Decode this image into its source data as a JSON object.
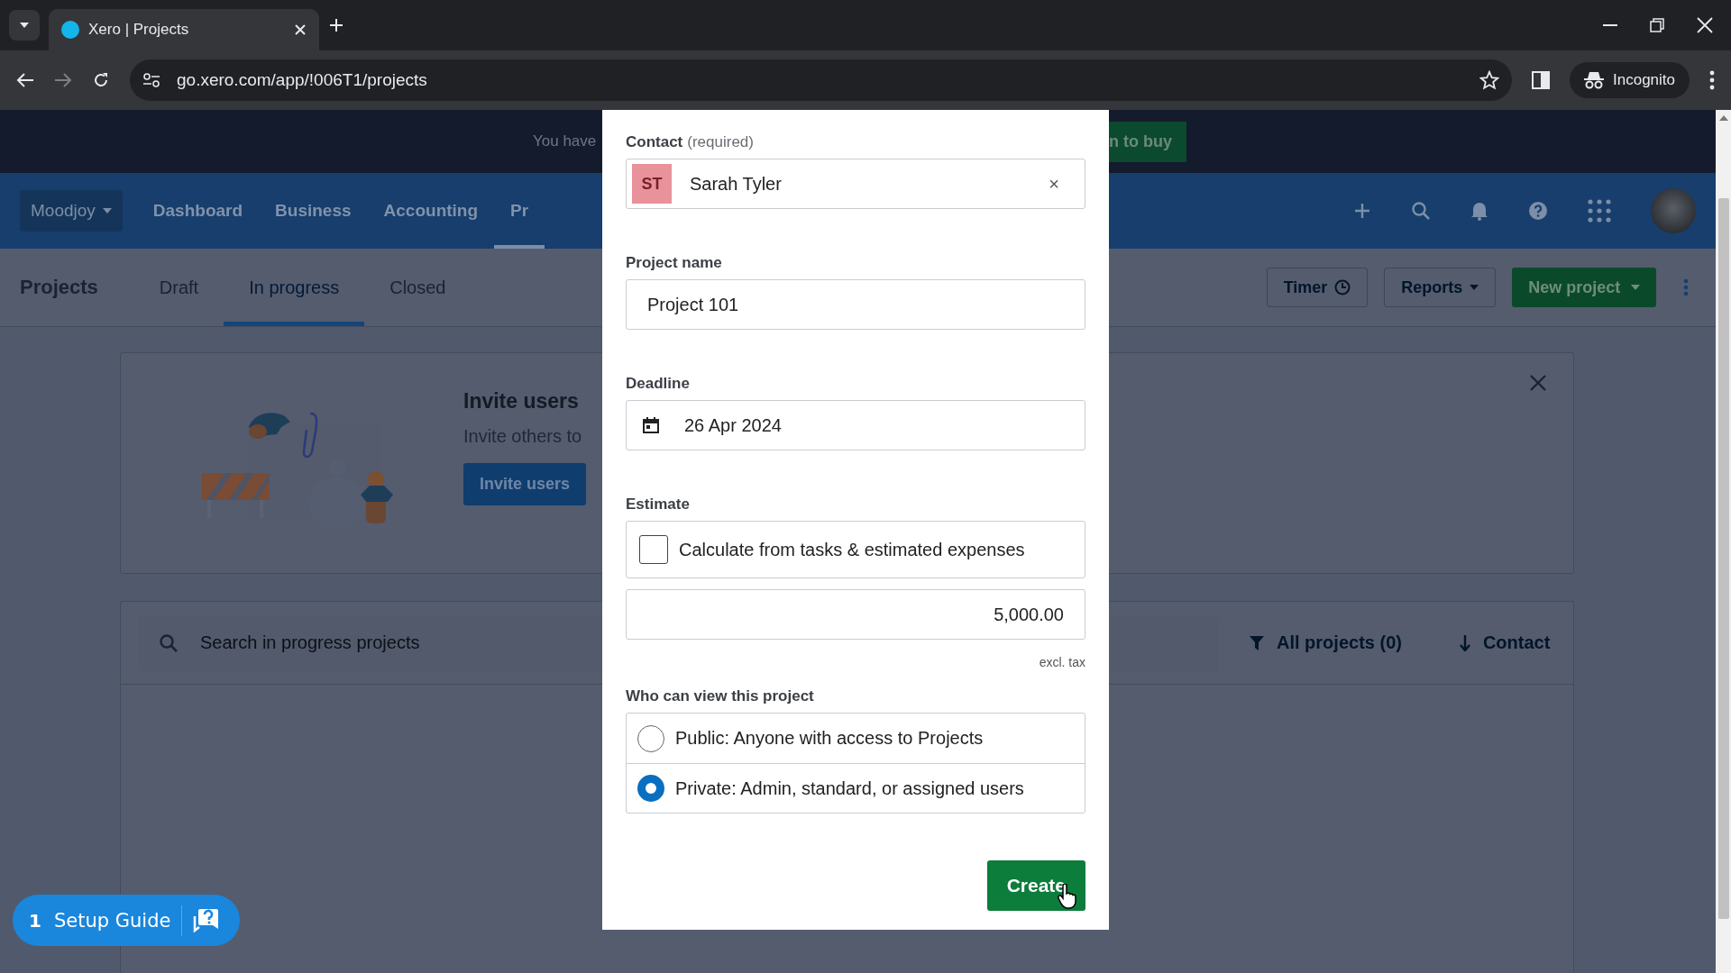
{
  "browser": {
    "tab_title": "Xero | Projects",
    "url": "go.xero.com/app/!006T1/projects",
    "profile": "Incognito"
  },
  "banner": {
    "text": "You have",
    "button": "n to buy"
  },
  "nav": {
    "org": "Moodjoy",
    "items": [
      {
        "label": "Dashboard",
        "selected": false
      },
      {
        "label": "Business",
        "selected": false
      },
      {
        "label": "Accounting",
        "selected": false
      },
      {
        "label": "Pr",
        "selected": true
      }
    ]
  },
  "subnav": {
    "title": "Projects",
    "tabs": [
      {
        "label": "Draft",
        "selected": false
      },
      {
        "label": "In progress",
        "selected": true
      },
      {
        "label": "Closed",
        "selected": false
      }
    ],
    "timer": "Timer",
    "reports": "Reports",
    "new_project": "New project"
  },
  "invite_card": {
    "heading": "Invite users",
    "text": "Invite others to",
    "button": "Invite users"
  },
  "search": {
    "placeholder": "Search in progress projects",
    "filter": "All projects (0)",
    "sort": "Contact"
  },
  "modal": {
    "contact": {
      "label": "Contact",
      "hint": "(required)",
      "initials": "ST",
      "value": "Sarah Tyler",
      "clear": "×"
    },
    "project_name": {
      "label": "Project name",
      "value": "Project 101"
    },
    "deadline": {
      "label": "Deadline",
      "value": "26 Apr 2024"
    },
    "estimate": {
      "label": "Estimate",
      "checkbox": {
        "label": "Calculate from tasks & estimated expenses",
        "checked": false
      },
      "amount": "5,000.00",
      "note": "excl. tax"
    },
    "visibility": {
      "label": "Who can view this project",
      "options": [
        {
          "label": "Public: Anyone with access to Projects",
          "selected": false
        },
        {
          "label": "Private: Admin, standard, or assigned users",
          "selected": true
        }
      ]
    },
    "create": "Create"
  },
  "setup_guide": {
    "count": "1",
    "label": "Setup Guide"
  }
}
